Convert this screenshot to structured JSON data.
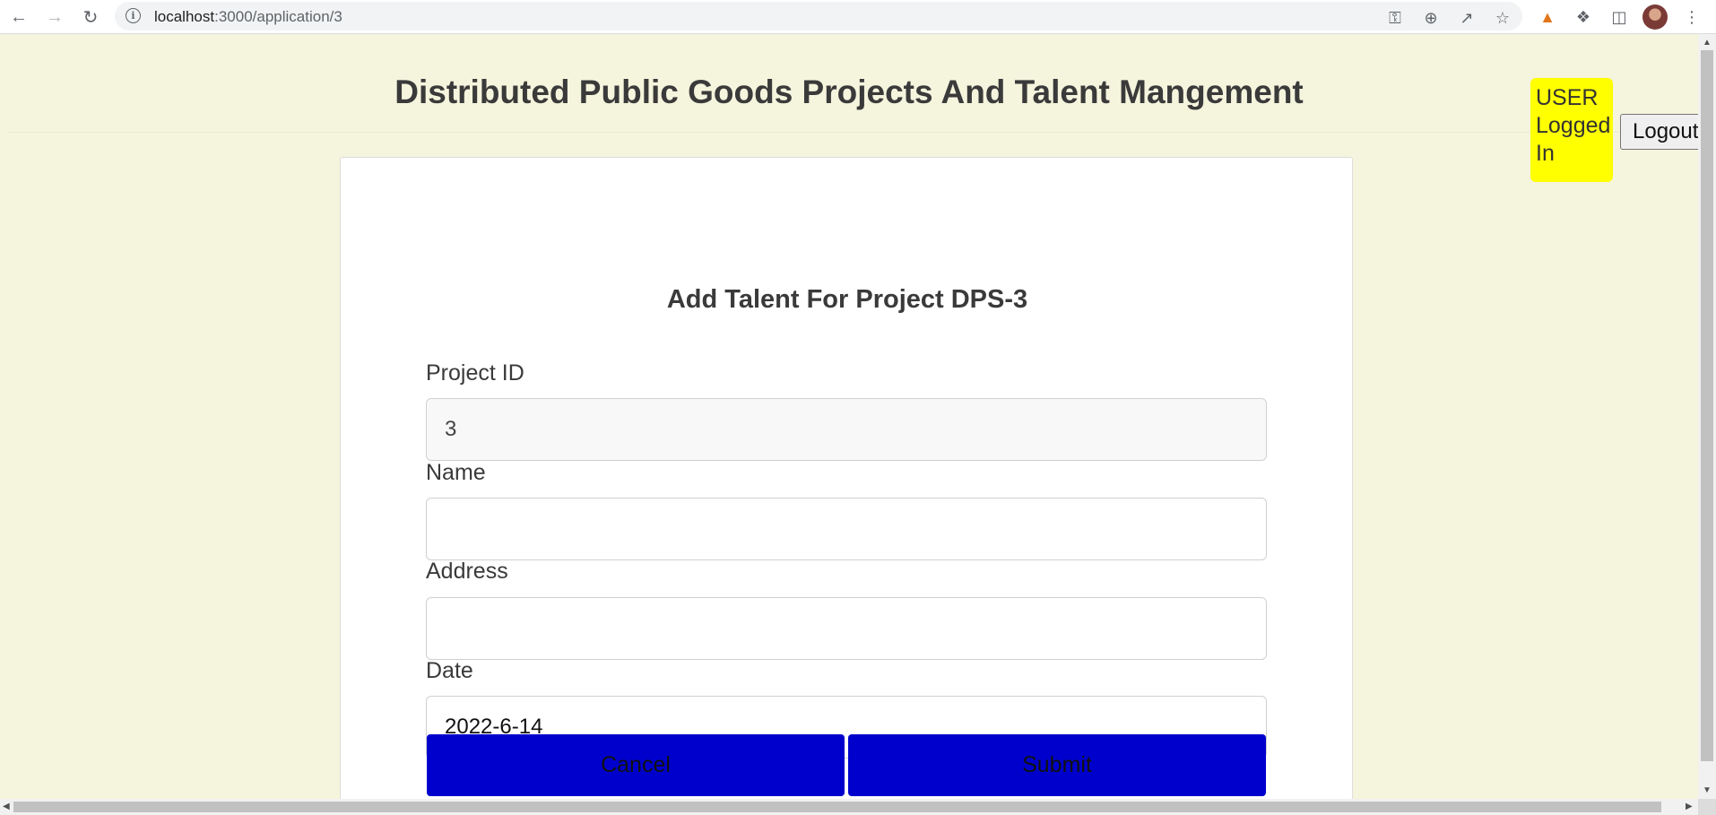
{
  "browser": {
    "url_host": "localhost",
    "url_path": ":3000/application/3",
    "back_icon": "arrow-left",
    "forward_icon": "arrow-right",
    "reload_icon": "reload"
  },
  "header": {
    "title": "Distributed Public Goods Projects And Talent Mangement",
    "user_status": "USER Logged In",
    "logout_label": "Logout"
  },
  "form": {
    "title": "Add Talent For Project DPS-3",
    "project_id_label": "Project ID",
    "project_id_value": "3",
    "name_label": "Name",
    "name_value": "",
    "address_label": "Address",
    "address_value": "",
    "date_label": "Date",
    "date_value": "2022-6-14",
    "cancel_label": "Cancel",
    "submit_label": "Submit"
  },
  "colors": {
    "page_bg": "#f5f4dd",
    "badge": "#ffff00",
    "button": "#0000cd"
  }
}
